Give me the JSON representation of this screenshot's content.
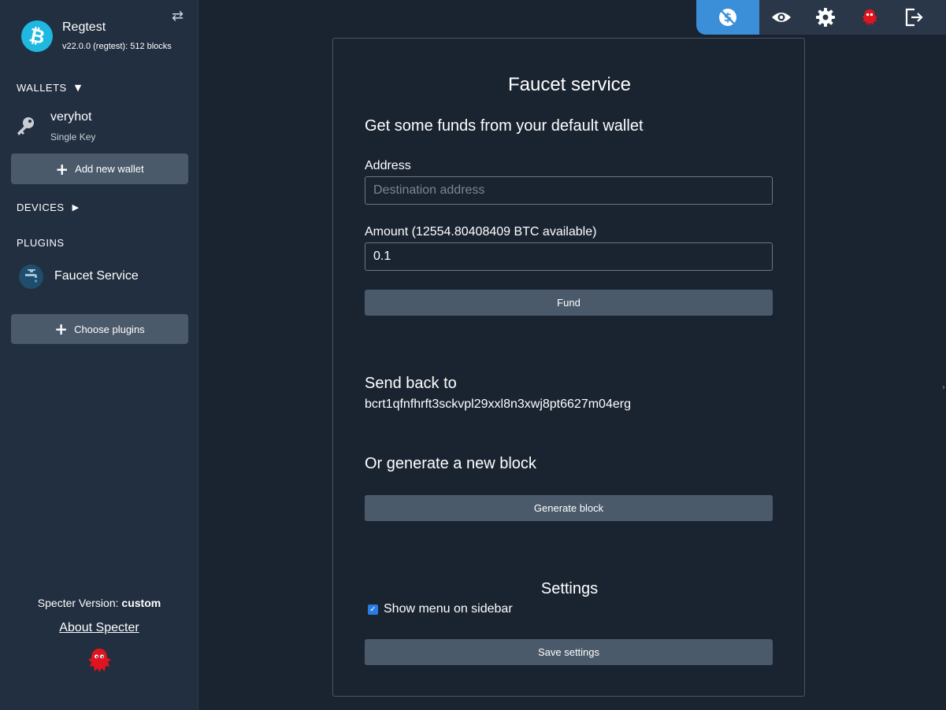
{
  "sidebar": {
    "network": {
      "name": "Regtest",
      "version": "v22.0.0 (regtest): 512 blocks"
    },
    "wallets": {
      "title": "WALLETS",
      "caret": "▼",
      "items": [
        {
          "name": "veryhot",
          "type": "Single Key"
        }
      ],
      "add_button": "Add new wallet"
    },
    "devices": {
      "title": "DEVICES",
      "caret": "▶"
    },
    "plugins": {
      "title": "PLUGINS",
      "items": [
        {
          "name": "Faucet Service"
        }
      ],
      "choose_button": "Choose plugins"
    },
    "footer": {
      "version_label": "Specter Version:",
      "version_value": "custom",
      "about": "About Specter"
    }
  },
  "toolbar": {
    "icons": [
      "faucet-icon",
      "eye-icon",
      "gear-icon",
      "ghost-icon",
      "logout-icon"
    ],
    "active_color": "#3b8fd9"
  },
  "faucet": {
    "title": "Faucet service",
    "subtitle": "Get some funds from your default wallet",
    "address_label": "Address",
    "address_placeholder": "Destination address",
    "address_value": "",
    "amount_label": "Amount (12554.80408409 BTC available)",
    "amount_value": "0.1",
    "fund_button": "Fund",
    "send_back_title": "Send back to",
    "send_back_address": "bcrt1qfnfhrft3sckvpl29xxl8n3xwj8pt6627m04erg",
    "generate_title": "Or generate a new block",
    "generate_button": "Generate block",
    "settings_title": "Settings",
    "show_menu_label": "Show menu on sidebar",
    "show_menu_checked": true,
    "save_button": "Save settings"
  },
  "colors": {
    "background": "#1a2431",
    "sidebar": "#222f40",
    "button": "#4b5a6b",
    "bitcoin_logo": "#1fb8e0",
    "ghost": "#e0141e"
  }
}
